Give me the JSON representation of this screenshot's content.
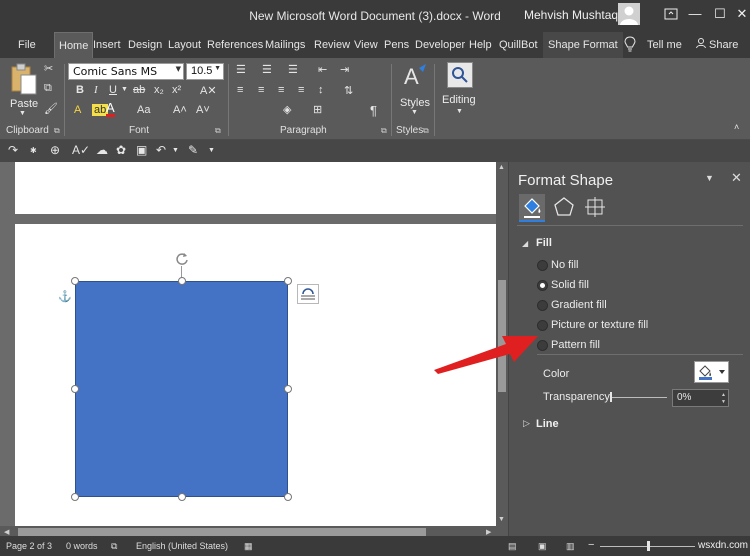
{
  "window": {
    "title": "New Microsoft Word Document (3).docx  -  Word",
    "user": "Mehvish Mushtaq",
    "minimize": "—",
    "restore": "❐",
    "maximize": "☐",
    "close": "✕"
  },
  "tabs": [
    {
      "label": "File"
    },
    {
      "label": "Home"
    },
    {
      "label": "Insert"
    },
    {
      "label": "Design"
    },
    {
      "label": "Layout"
    },
    {
      "label": "References"
    },
    {
      "label": "Mailings"
    },
    {
      "label": "Review"
    },
    {
      "label": "View"
    },
    {
      "label": "Pens"
    },
    {
      "label": "Developer"
    },
    {
      "label": "Help"
    },
    {
      "label": "QuillBot"
    },
    {
      "label": "Shape Format"
    },
    {
      "label": "Tell me"
    },
    {
      "label": "Share"
    }
  ],
  "ribbon": {
    "clipboard": {
      "paste": "Paste",
      "label": "Clipboard"
    },
    "font": {
      "family": "Comic Sans MS",
      "size": "10.5",
      "label": "Font"
    },
    "paragraph": {
      "label": "Paragraph"
    },
    "styles": {
      "button": "Styles",
      "label": "Styles"
    },
    "editing": {
      "button": "Editing"
    }
  },
  "pane": {
    "title": "Format Shape",
    "fill_section": "Fill",
    "fill_options": [
      {
        "label": "No fill",
        "selected": false
      },
      {
        "label": "Solid fill",
        "selected": true
      },
      {
        "label": "Gradient fill",
        "selected": false
      },
      {
        "label": "Picture or texture fill",
        "selected": false
      },
      {
        "label": "Pattern fill",
        "selected": false
      }
    ],
    "color_label": "Color",
    "transparency_label": "Transparency",
    "transparency_value": "0%",
    "line_section": "Line"
  },
  "status": {
    "page": "Page 2 of 3",
    "words": "0 words",
    "language": "English (United States)"
  },
  "watermark": "wsxdn.com",
  "colors": {
    "shape_fill": "#4472c4",
    "arrow": "#e02020",
    "accent": "#2f7fe0"
  }
}
